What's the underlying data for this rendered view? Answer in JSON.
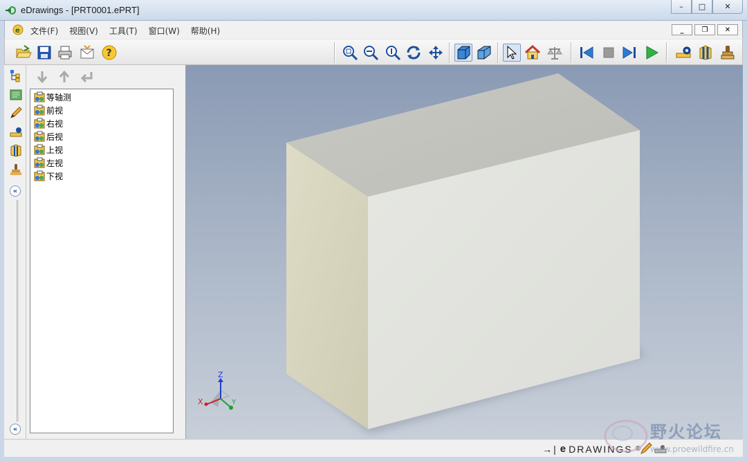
{
  "window": {
    "title": "eDrawings - [PRT0001.ePRT]",
    "minimize_label": "–",
    "maximize_label": "□",
    "close_label": "✕"
  },
  "menubar": {
    "items": [
      "文件(F)",
      "视图(V)",
      "工具(T)",
      "窗口(W)",
      "帮助(H)"
    ],
    "doc_minimize": "_",
    "doc_restore": "❐",
    "doc_close": "✕"
  },
  "toolbar": {
    "icons": [
      "open-icon",
      "save-icon",
      "print-icon",
      "send-mail-icon",
      "help-icon",
      "zoom-to-fit-icon",
      "zoom-in-out-icon",
      "zoom-to-area-icon",
      "rotate-icon",
      "pan-icon",
      "shaded-icon",
      "perspective-icon",
      "select-icon",
      "home-icon",
      "balance-icon",
      "first-frame-icon",
      "stop-icon",
      "next-frame-icon",
      "play-icon",
      "measure-icon",
      "section-icon",
      "stamp-icon"
    ]
  },
  "left_strip": {
    "icons": [
      "component-tree-icon",
      "sheet-format-icon",
      "markup-pen-icon",
      "measure-icon",
      "section-icon",
      "stamp-icon"
    ],
    "collapse_top": "«",
    "collapse_bottom": "«"
  },
  "panel": {
    "nav_icons": [
      "down-arrow-icon",
      "up-arrow-icon",
      "return-arrow-icon"
    ],
    "tree_items": [
      "等轴测",
      "前视",
      "右视",
      "后视",
      "上视",
      "左视",
      "下视"
    ]
  },
  "viewport": {
    "triad": {
      "z": "Z",
      "x": "X",
      "y": "Y"
    },
    "colors": {
      "box_top": "#c4c4bf",
      "box_front": "#e3e4df",
      "box_side": "#d8d6c0"
    }
  },
  "statusbar": {
    "brand_prefix": "→|",
    "brand_e": "e",
    "brand_text": "DRAWINGS",
    "brand_reg": "®"
  },
  "watermark": {
    "title": "野火论坛",
    "url": "www.proewildfire.cn"
  }
}
